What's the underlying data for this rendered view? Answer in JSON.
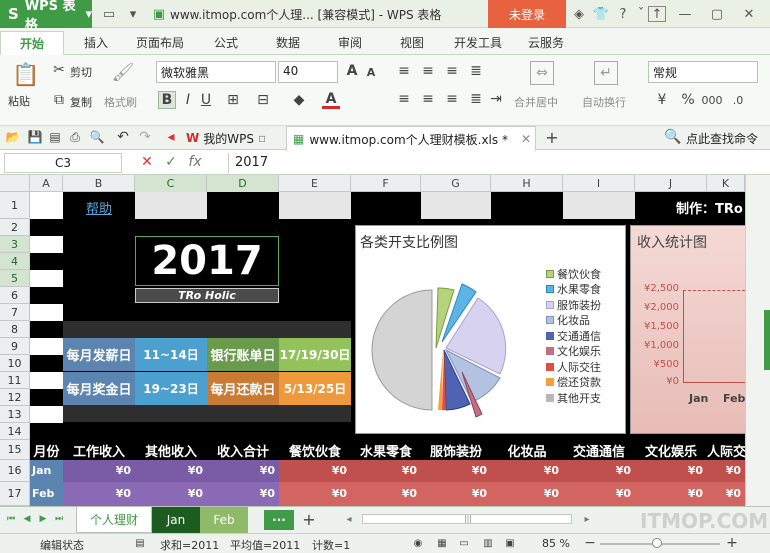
{
  "app": {
    "name": "WPS 表格",
    "title": "www.itmop.com个人理... [兼容模式] - WPS 表格",
    "login": "未登录"
  },
  "menu": [
    "开始",
    "插入",
    "页面布局",
    "公式",
    "数据",
    "审阅",
    "视图",
    "开发工具",
    "云服务"
  ],
  "ribbon": {
    "cut": "剪切",
    "copy": "复制",
    "paste": "粘贴",
    "format_painter": "格式刷",
    "font": "微软雅黑",
    "size": "40",
    "merge": "合并居中",
    "wrap": "自动换行",
    "number_format": "常规"
  },
  "tabs": {
    "mywps": "我的WPS",
    "file": "www.itmop.com个人理财模板.xls *",
    "search": "点此查找命令"
  },
  "formula": {
    "cell": "C3",
    "value": "2017"
  },
  "columns": [
    "A",
    "B",
    "C",
    "D",
    "E",
    "F",
    "G",
    "H",
    "I",
    "J",
    "K"
  ],
  "rows": [
    "1",
    "2",
    "3",
    "4",
    "5",
    "6",
    "7",
    "8",
    "9",
    "10",
    "11",
    "12",
    "13",
    "14",
    "15",
    "16",
    "17"
  ],
  "sheet": {
    "help": "帮助",
    "maker": "制作：TRo",
    "year": "2017",
    "brand": "TRo Holic",
    "info": [
      [
        "每月发薪日",
        "11~14日",
        "银行账单日",
        "17/19/30日"
      ],
      [
        "每月奖金日",
        "19~23日",
        "每月还款日",
        "5/13/25日"
      ]
    ],
    "pie": {
      "title": "各类开支比例图",
      "legend": [
        "餐饮伙食",
        "水果零食",
        "服饰装扮",
        "化妆品",
        "交通通信",
        "文化娱乐",
        "人际交往",
        "偿还贷款",
        "其他开支"
      ],
      "colors": [
        "#b5d37a",
        "#5bb4e6",
        "#d7d2ef",
        "#b3c2e0",
        "#4e63b2",
        "#c06f84",
        "#e34c3e",
        "#f2a13c",
        "#b8b8b8"
      ]
    },
    "income": {
      "title": "收入统计图",
      "yticks": [
        "¥2,500",
        "¥2,000",
        "¥1,500",
        "¥1,000",
        "¥500",
        "¥0"
      ],
      "xticks": [
        "Jan",
        "Feb"
      ]
    },
    "headers": [
      "月份",
      "工作收入",
      "其他收入",
      "收入合计",
      "餐饮伙食",
      "水果零食",
      "服饰装扮",
      "化妆品",
      "交通通信",
      "文化娱乐",
      "人际交"
    ],
    "data": [
      [
        "Jan",
        "¥0",
        "¥0",
        "¥0",
        "¥0",
        "¥0",
        "¥0",
        "¥0",
        "¥0",
        "¥0",
        "¥0"
      ],
      [
        "Feb",
        "¥0",
        "¥0",
        "¥0",
        "¥0",
        "¥0",
        "¥0",
        "¥0",
        "¥0",
        "¥0",
        "¥0"
      ]
    ]
  },
  "sheet_tabs": [
    "个人理财",
    "Jan",
    "Feb"
  ],
  "status": {
    "mode": "编辑状态",
    "sum": "求和=2011",
    "avg": "平均值=2011",
    "count": "计数=1",
    "zoom": "85 %"
  },
  "watermark": "ITMOP.COM"
}
